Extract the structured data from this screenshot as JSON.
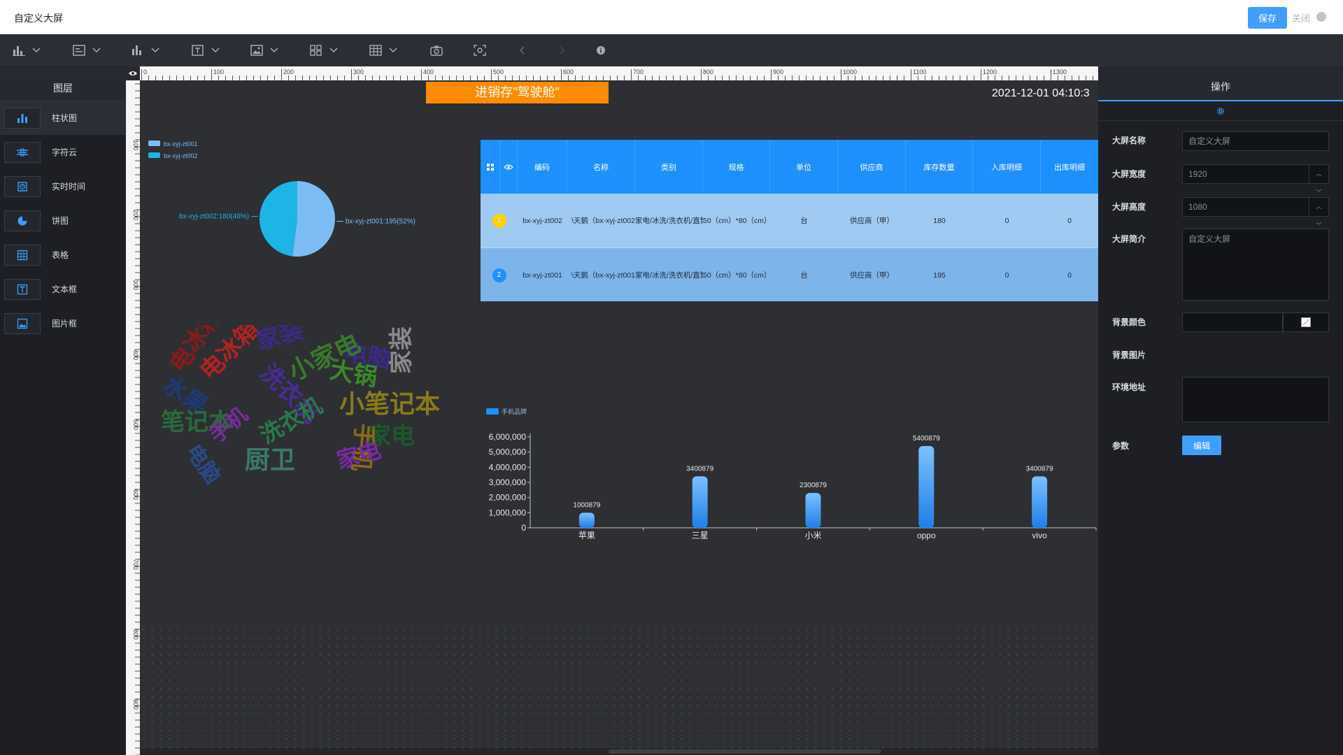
{
  "header": {
    "title": "自定义大屏",
    "save_label": "保存",
    "close_label": "关闭"
  },
  "toolbar": {
    "tools": [
      "bar-chart-icon",
      "text-list-icon",
      "column-chart-icon",
      "text-box-icon",
      "image-icon",
      "grid-apps-icon",
      "table-icon",
      "camera-icon",
      "screenshot-icon",
      "undo-arrow-icon",
      "redo-arrow-icon",
      "info-icon"
    ]
  },
  "layers": {
    "title": "图层",
    "items": [
      {
        "label": "柱状图",
        "icon": "bar-chart-icon"
      },
      {
        "label": "字符云",
        "icon": "word-cloud-icon"
      },
      {
        "label": "实时时间",
        "icon": "clock-icon"
      },
      {
        "label": "饼图",
        "icon": "pie-chart-icon"
      },
      {
        "label": "表格",
        "icon": "table-icon"
      },
      {
        "label": "文本框",
        "icon": "text-box-icon"
      },
      {
        "label": "图片框",
        "icon": "image-icon"
      }
    ]
  },
  "ruler": {
    "top_ticks": [
      "0",
      "100",
      "200",
      "300",
      "400",
      "500",
      "600",
      "700",
      "800",
      "900",
      "1000",
      "1100",
      "1200",
      "1300"
    ],
    "left_ticks": [
      "100",
      "200",
      "300",
      "400",
      "500",
      "600",
      "700",
      "800",
      "900"
    ]
  },
  "canvas": {
    "banner": "进销存\"驾驶舱\"",
    "clock": "2021-12-01 04:10:3",
    "wordcloud": [
      "水果",
      "电冰箱",
      "电冰箱",
      "家装",
      "电脑",
      "家装",
      "洗衣机",
      "小家电",
      "大锅",
      "小笔记本",
      "笔记本",
      "手机",
      "洗衣机",
      "家电",
      "手机",
      "电脑",
      "厨卫",
      "家电"
    ]
  },
  "table": {
    "headers": [
      "编码",
      "名称",
      "类别",
      "规格",
      "单位",
      "供应商",
      "库存数量",
      "入库明细",
      "出库明细"
    ],
    "rows": [
      {
        "index": "1",
        "code": "bx-xyj-zt002",
        "name": "\\天鹅（bx-xyj-zt002）",
        "category": "家电/冰洗/洗衣机/直筒",
        "spec": "50（cm）*80（cm）",
        "unit": "台",
        "supplier": "供应商（甲）",
        "stock": "180",
        "in": "0",
        "out": "0",
        "badge_color": "#ffd200"
      },
      {
        "index": "2",
        "code": "bx-xyj-zt001",
        "name": "\\天鹅（bx-xyj-zt001）",
        "category": "家电/冰洗/洗衣机/直筒",
        "spec": "50（cm）*80（cm）",
        "unit": "台",
        "supplier": "供应商（甲）",
        "stock": "195",
        "in": "0",
        "out": "0",
        "badge_color": "#1e90ff"
      }
    ]
  },
  "chart_data": [
    {
      "type": "pie",
      "categories": [
        "bx-xyj-zt001",
        "bx-xyj-zt002"
      ],
      "values": [
        195,
        180
      ],
      "labels": [
        "bx-xyj-zt001:195(52%)",
        "bx-xyj-zt002:180(48%)"
      ],
      "colors": [
        "#7cbcf5",
        "#1eb4e6"
      ],
      "legend": "top-left"
    },
    {
      "type": "bar",
      "legend_name": "手机品牌",
      "categories": [
        "苹果",
        "三星",
        "小米",
        "oppo",
        "vivo"
      ],
      "values": [
        1000879,
        3400879,
        2300879,
        5400879,
        3400879
      ],
      "value_labels": [
        "1000879",
        "3400879",
        "2300879",
        "5400879",
        "3400879"
      ],
      "y_ticks": [
        "6,000,000",
        "5,000,000",
        "4,000,000",
        "3,000,000",
        "2,000,000",
        "1,000,000",
        "0"
      ],
      "ylim": [
        0,
        6000000
      ],
      "legend": "top-left",
      "bar_color": "#1e90ff"
    }
  ],
  "props": {
    "title": "操作",
    "fields": {
      "name_label": "大屏名称",
      "name_value": "自定义大屏",
      "width_label": "大屏宽度",
      "width_value": "1920",
      "height_label": "大屏高度",
      "height_value": "1080",
      "desc_label": "大屏简介",
      "desc_value": "自定义大屏",
      "bgcolor_label": "背景颜色",
      "bgimage_label": "背景图片",
      "env_label": "环境地址",
      "param_label": "参数",
      "edit_label": "编辑"
    }
  }
}
